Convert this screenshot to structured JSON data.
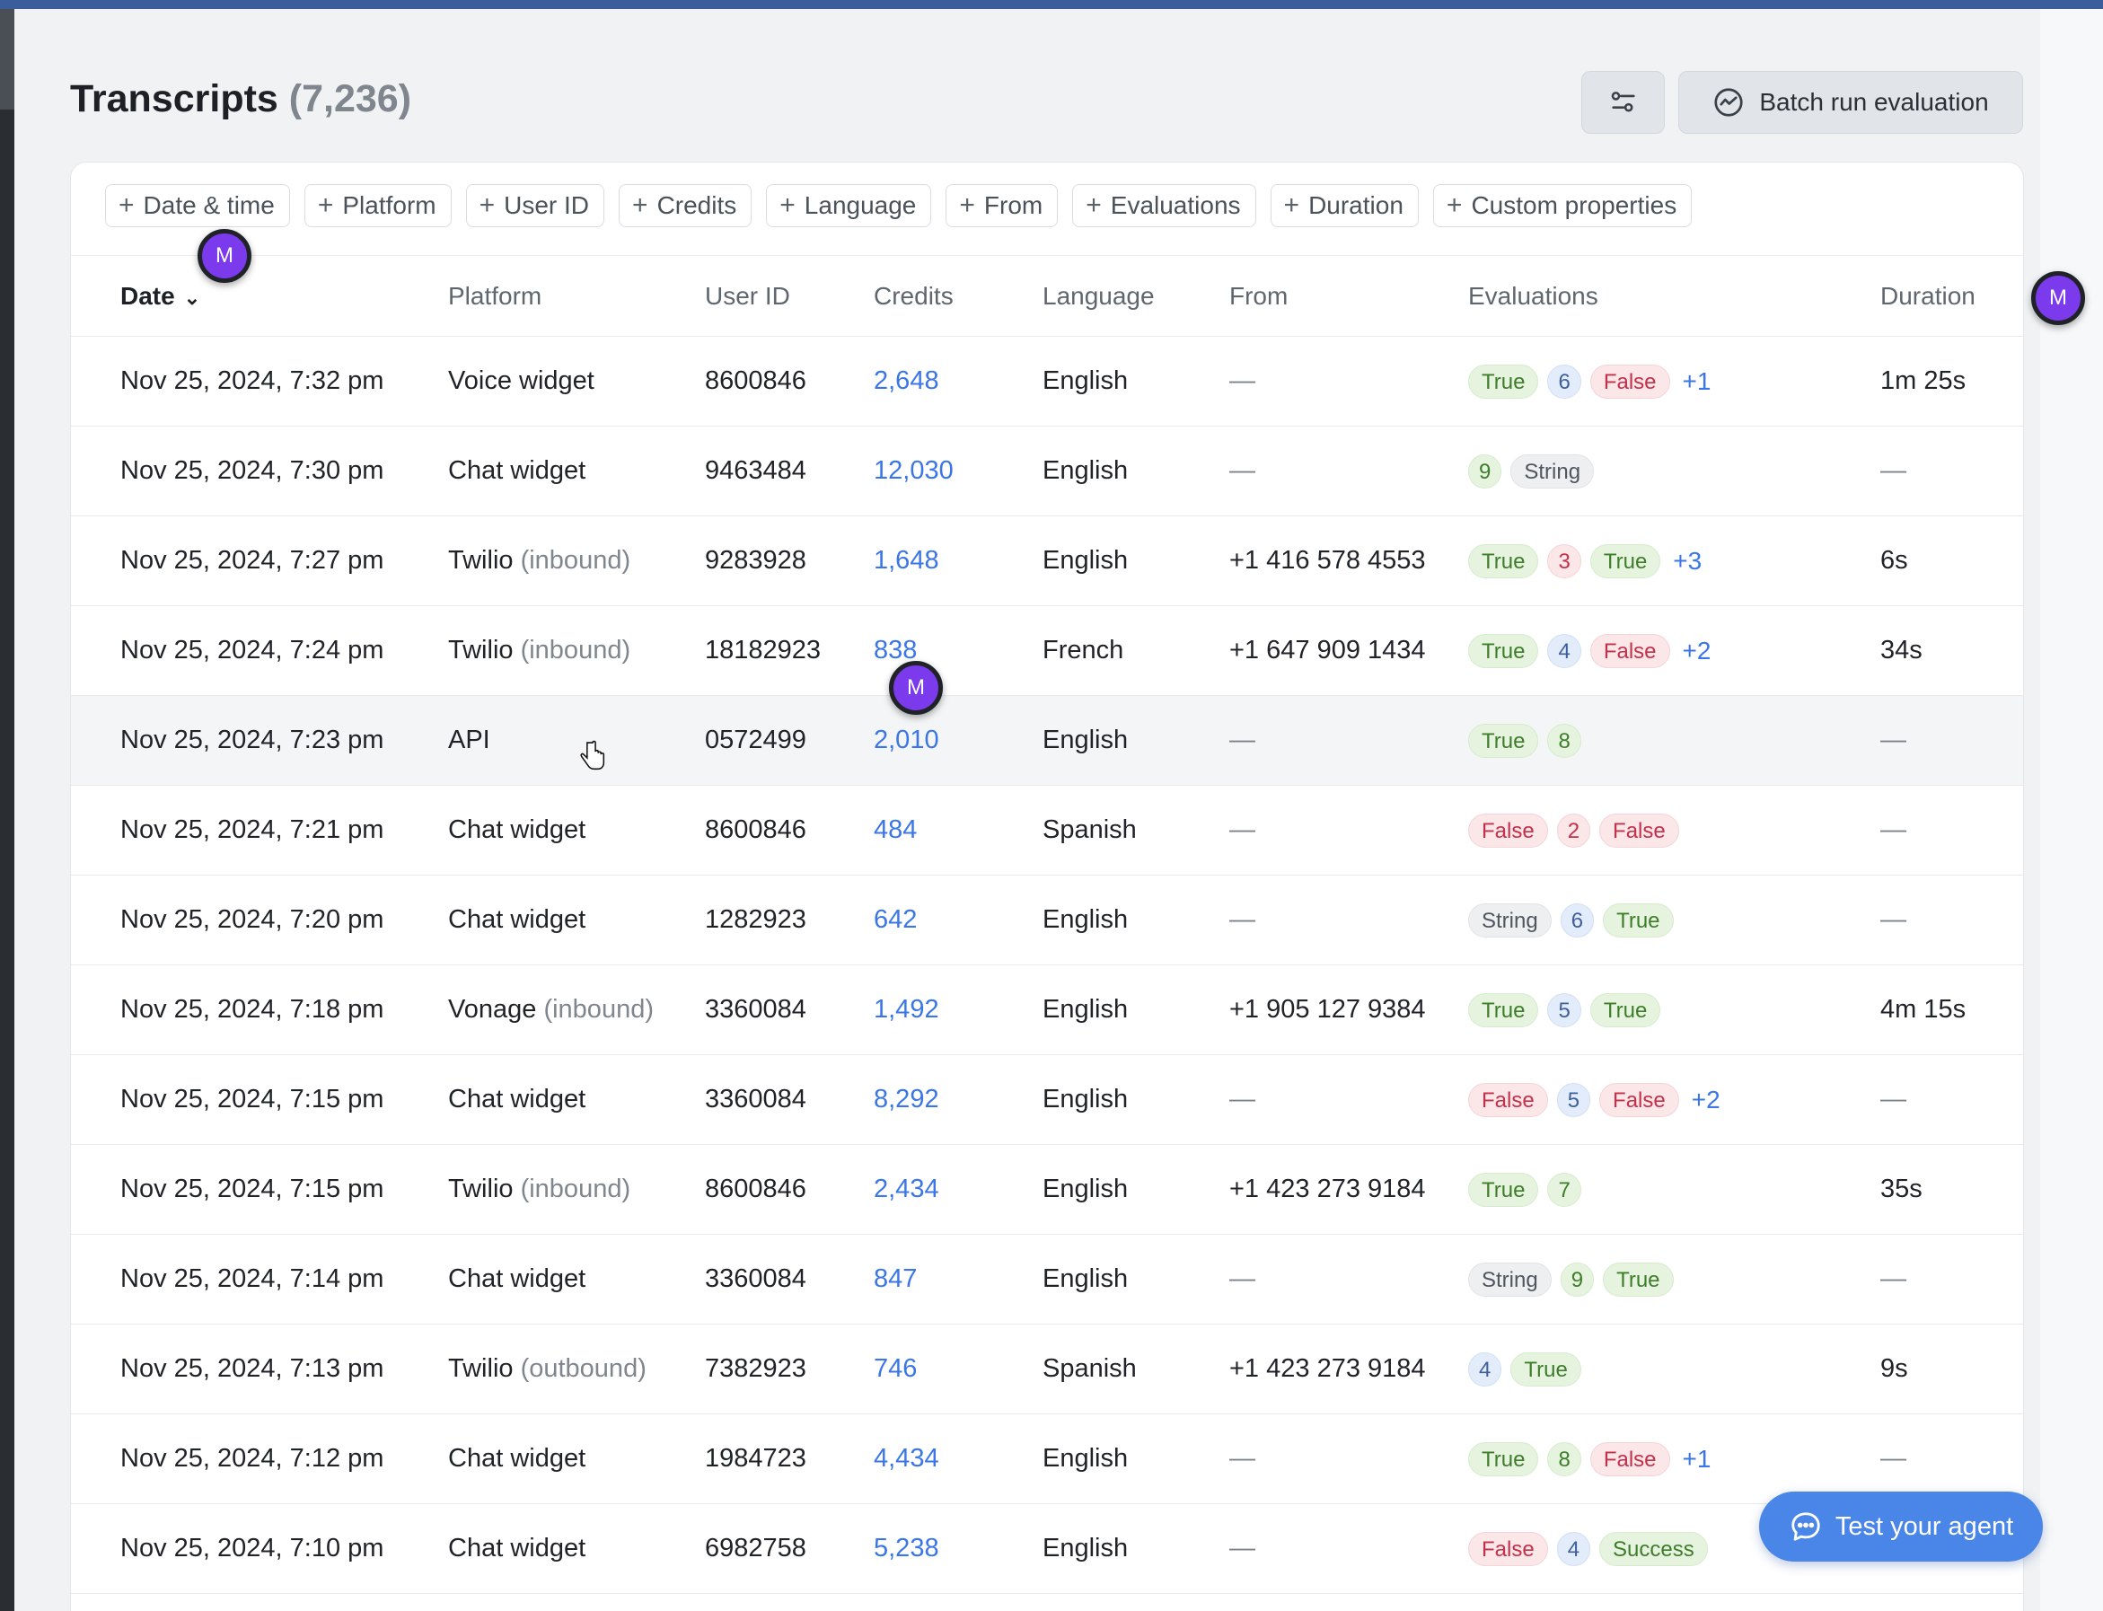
{
  "header": {
    "title": "Transcripts",
    "count": "(7,236)",
    "filter_settings_icon": "sliders-icon",
    "batch_button_label": "Batch run evaluation",
    "batch_button_icon": "activity-chart-icon"
  },
  "filters": [
    "Date & time",
    "Platform",
    "User ID",
    "Credits",
    "Language",
    "From",
    "Evaluations",
    "Duration",
    "Custom properties"
  ],
  "columns": {
    "date": "Date",
    "platform": "Platform",
    "user_id": "User ID",
    "credits": "Credits",
    "language": "Language",
    "from": "From",
    "evaluations": "Evaluations",
    "duration": "Duration"
  },
  "rows": [
    {
      "date": "Nov 25, 2024, 7:32 pm",
      "platform": "Voice widget",
      "direction": "",
      "user_id": "8600846",
      "credits": "2,648",
      "language": "English",
      "from": "—",
      "evals": [
        {
          "t": "true",
          "v": "True"
        },
        {
          "t": "num",
          "c": "blue",
          "v": "6"
        },
        {
          "t": "false",
          "v": "False"
        }
      ],
      "more": "+1",
      "duration": "1m 25s"
    },
    {
      "date": "Nov 25, 2024, 7:30 pm",
      "platform": "Chat widget",
      "direction": "",
      "user_id": "9463484",
      "credits": "12,030",
      "language": "English",
      "from": "—",
      "evals": [
        {
          "t": "num",
          "c": "green",
          "v": "9"
        },
        {
          "t": "string",
          "v": "String"
        }
      ],
      "more": "",
      "duration": "—"
    },
    {
      "date": "Nov 25, 2024, 7:27 pm",
      "platform": "Twilio",
      "direction": "(inbound)",
      "user_id": "9283928",
      "credits": "1,648",
      "language": "English",
      "from": "+1 416 578 4553",
      "evals": [
        {
          "t": "true",
          "v": "True"
        },
        {
          "t": "num",
          "c": "red",
          "v": "3"
        },
        {
          "t": "true",
          "v": "True"
        }
      ],
      "more": "+3",
      "duration": "6s"
    },
    {
      "date": "Nov 25, 2024, 7:24 pm",
      "platform": "Twilio",
      "direction": "(inbound)",
      "user_id": "18182923",
      "credits": "838",
      "language": "French",
      "from": "+1 647 909 1434",
      "evals": [
        {
          "t": "true",
          "v": "True"
        },
        {
          "t": "num",
          "c": "blue",
          "v": "4"
        },
        {
          "t": "false",
          "v": "False"
        }
      ],
      "more": "+2",
      "duration": "34s"
    },
    {
      "date": "Nov 25, 2024, 7:23 pm",
      "platform": "API",
      "direction": "",
      "user_id": "0572499",
      "credits": "2,010",
      "language": "English",
      "from": "—",
      "evals": [
        {
          "t": "true",
          "v": "True"
        },
        {
          "t": "num",
          "c": "green",
          "v": "8"
        }
      ],
      "more": "",
      "duration": "—"
    },
    {
      "date": "Nov 25, 2024, 7:21 pm",
      "platform": "Chat widget",
      "direction": "",
      "user_id": "8600846",
      "credits": "484",
      "language": "Spanish",
      "from": "—",
      "evals": [
        {
          "t": "false",
          "v": "False"
        },
        {
          "t": "num",
          "c": "red",
          "v": "2"
        },
        {
          "t": "false",
          "v": "False"
        }
      ],
      "more": "",
      "duration": "—"
    },
    {
      "date": "Nov 25, 2024, 7:20 pm",
      "platform": "Chat widget",
      "direction": "",
      "user_id": "1282923",
      "credits": "642",
      "language": "English",
      "from": "—",
      "evals": [
        {
          "t": "string",
          "v": "String"
        },
        {
          "t": "num",
          "c": "blue",
          "v": "6"
        },
        {
          "t": "true",
          "v": "True"
        }
      ],
      "more": "",
      "duration": "—"
    },
    {
      "date": "Nov 25, 2024, 7:18 pm",
      "platform": "Vonage",
      "direction": "(inbound)",
      "user_id": "3360084",
      "credits": "1,492",
      "language": "English",
      "from": "+1 905 127 9384",
      "evals": [
        {
          "t": "true",
          "v": "True"
        },
        {
          "t": "num",
          "c": "blue",
          "v": "5"
        },
        {
          "t": "true",
          "v": "True"
        }
      ],
      "more": "",
      "duration": "4m 15s"
    },
    {
      "date": "Nov 25, 2024, 7:15 pm",
      "platform": "Chat widget",
      "direction": "",
      "user_id": "3360084",
      "credits": "8,292",
      "language": "English",
      "from": "—",
      "evals": [
        {
          "t": "false",
          "v": "False"
        },
        {
          "t": "num",
          "c": "blue",
          "v": "5"
        },
        {
          "t": "false",
          "v": "False"
        }
      ],
      "more": "+2",
      "duration": "—"
    },
    {
      "date": "Nov 25, 2024, 7:15 pm",
      "platform": "Twilio",
      "direction": "(inbound)",
      "user_id": "8600846",
      "credits": "2,434",
      "language": "English",
      "from": "+1 423 273 9184",
      "evals": [
        {
          "t": "true",
          "v": "True"
        },
        {
          "t": "num",
          "c": "green",
          "v": "7"
        }
      ],
      "more": "",
      "duration": "35s"
    },
    {
      "date": "Nov 25, 2024, 7:14 pm",
      "platform": "Chat widget",
      "direction": "",
      "user_id": "3360084",
      "credits": "847",
      "language": "English",
      "from": "—",
      "evals": [
        {
          "t": "string",
          "v": "String"
        },
        {
          "t": "num",
          "c": "green",
          "v": "9"
        },
        {
          "t": "true",
          "v": "True"
        }
      ],
      "more": "",
      "duration": "—"
    },
    {
      "date": "Nov 25, 2024, 7:13 pm",
      "platform": "Twilio",
      "direction": "(outbound)",
      "user_id": "7382923",
      "credits": "746",
      "language": "Spanish",
      "from": "+1 423 273 9184",
      "evals": [
        {
          "t": "num",
          "c": "blue",
          "v": "4"
        },
        {
          "t": "true",
          "v": "True"
        }
      ],
      "more": "",
      "duration": "9s"
    },
    {
      "date": "Nov 25, 2024, 7:12 pm",
      "platform": "Chat widget",
      "direction": "",
      "user_id": "1984723",
      "credits": "4,434",
      "language": "English",
      "from": "—",
      "evals": [
        {
          "t": "true",
          "v": "True"
        },
        {
          "t": "num",
          "c": "green",
          "v": "8"
        },
        {
          "t": "false",
          "v": "False"
        }
      ],
      "more": "+1",
      "duration": "—"
    },
    {
      "date": "Nov 25, 2024, 7:10 pm",
      "platform": "Chat widget",
      "direction": "",
      "user_id": "6982758",
      "credits": "5,238",
      "language": "English",
      "from": "—",
      "evals": [
        {
          "t": "false",
          "v": "False"
        },
        {
          "t": "num",
          "c": "blue",
          "v": "4"
        },
        {
          "t": "success",
          "v": "Success"
        }
      ],
      "more": "",
      "duration": ""
    }
  ],
  "avatars": [
    "M",
    "M",
    "M"
  ],
  "test_agent": {
    "label": "Test your agent",
    "icon": "chat-bubble-icon"
  },
  "colors": {
    "accent": "#3b76e8",
    "avatar": "#7c3aed",
    "true_green": "#3e7d2a",
    "false_red": "#c4314b"
  }
}
